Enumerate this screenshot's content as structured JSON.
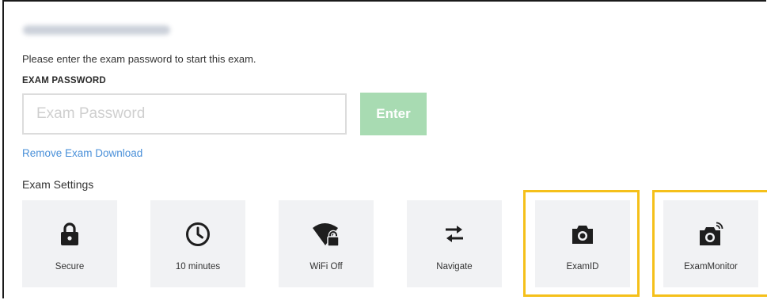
{
  "instruction": "Please enter the exam password to start this exam.",
  "password": {
    "label": "EXAM PASSWORD",
    "placeholder": "Exam Password",
    "value": ""
  },
  "enter_button": "Enter",
  "remove_link": "Remove Exam Download",
  "settings": {
    "heading": "Exam Settings",
    "tiles": [
      {
        "label": "Secure",
        "icon": "lock-icon"
      },
      {
        "label": "10 minutes",
        "icon": "clock-icon"
      },
      {
        "label": "WiFi Off",
        "icon": "wifi-lock-icon"
      },
      {
        "label": "Navigate",
        "icon": "swap-arrows-icon"
      },
      {
        "label": "ExamID",
        "icon": "camera-icon",
        "highlighted": true
      },
      {
        "label": "ExamMonitor",
        "icon": "camera-monitor-icon",
        "highlighted": true
      }
    ]
  },
  "colors": {
    "accent_green": "#a8dbb2",
    "link_blue": "#4a90d9",
    "highlight_yellow": "#f5c01a",
    "tile_bg": "#f1f2f4"
  }
}
